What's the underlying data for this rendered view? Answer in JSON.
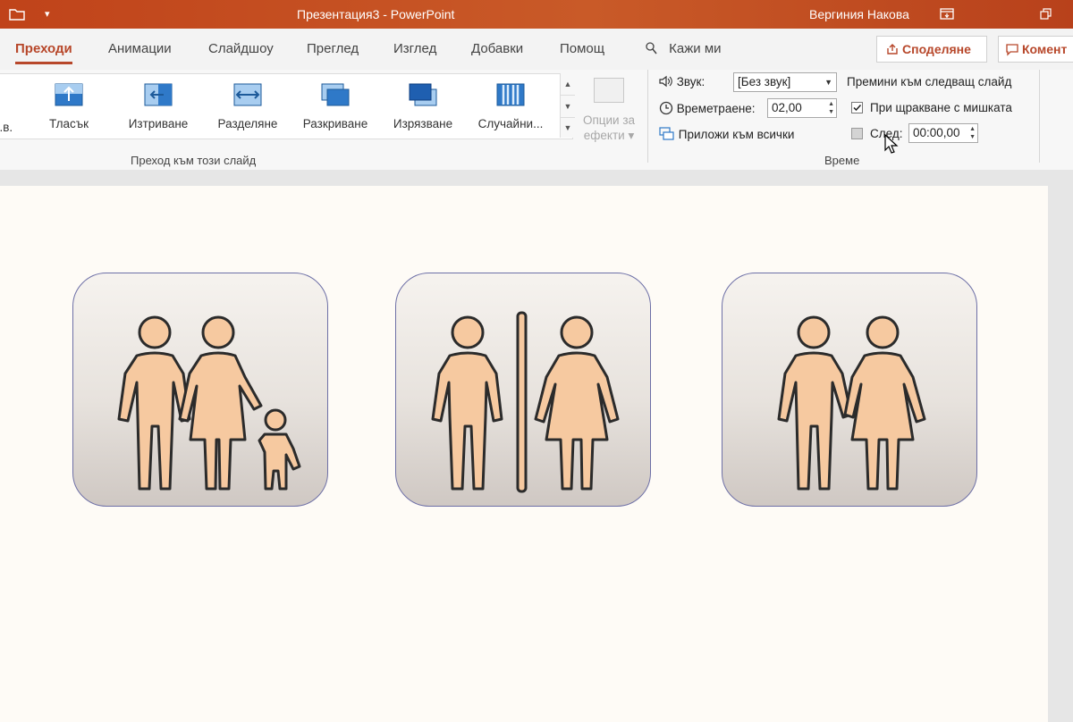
{
  "titlebar": {
    "doc_title": "Презентация3  -  PowerPoint",
    "user": "Вергиния Накова",
    "qat_dropdown": "▾",
    "ribbon_display_icon": "ribbon-display-options-icon",
    "restore_icon": "restore-window-icon"
  },
  "tabs": [
    {
      "label": "Преходи",
      "active": true
    },
    {
      "label": "Анимации"
    },
    {
      "label": "Слайдшоу"
    },
    {
      "label": "Преглед"
    },
    {
      "label": "Изглед"
    },
    {
      "label": "Добавки"
    },
    {
      "label": "Помощ"
    }
  ],
  "tell_me": "Кажи ми",
  "share_button": "Споделяне",
  "comments_button": "Комент",
  "transitions_gallery": {
    "partial_item": "...в.",
    "items": [
      {
        "label": "Тласък",
        "icon": "push-transition-icon"
      },
      {
        "label": "Изтриване",
        "icon": "wipe-transition-icon"
      },
      {
        "label": "Разделяне",
        "icon": "split-transition-icon"
      },
      {
        "label": "Разкриване",
        "icon": "reveal-transition-icon"
      },
      {
        "label": "Изрязване",
        "icon": "cut-transition-icon"
      },
      {
        "label": "Случайни...",
        "icon": "random-bars-transition-icon"
      }
    ],
    "group_label": "Преход към този слайд"
  },
  "effect_options": {
    "line1": "Опции за",
    "line2": "ефекти"
  },
  "timing": {
    "sound_label": "Звук:",
    "sound_value": "[Без звук]",
    "duration_label": "Времетраене:",
    "duration_value": "02,00",
    "apply_all": "Приложи към всички",
    "group_label": "Време",
    "advance_header": "Премини към следващ слайд",
    "on_click_label": "При щракване с мишката",
    "on_click_checked": true,
    "after_label": "След:",
    "after_value": "00:00,00",
    "after_checked": false
  },
  "slide": {
    "cards": [
      {
        "name": "family-icon"
      },
      {
        "name": "restroom-icon"
      },
      {
        "name": "couple-icon"
      }
    ],
    "figure_fill": "#f6c9a0",
    "figure_stroke": "#2b2b2b"
  },
  "colors": {
    "accent": "#b7472a",
    "titlebar": "#c24a1a"
  }
}
